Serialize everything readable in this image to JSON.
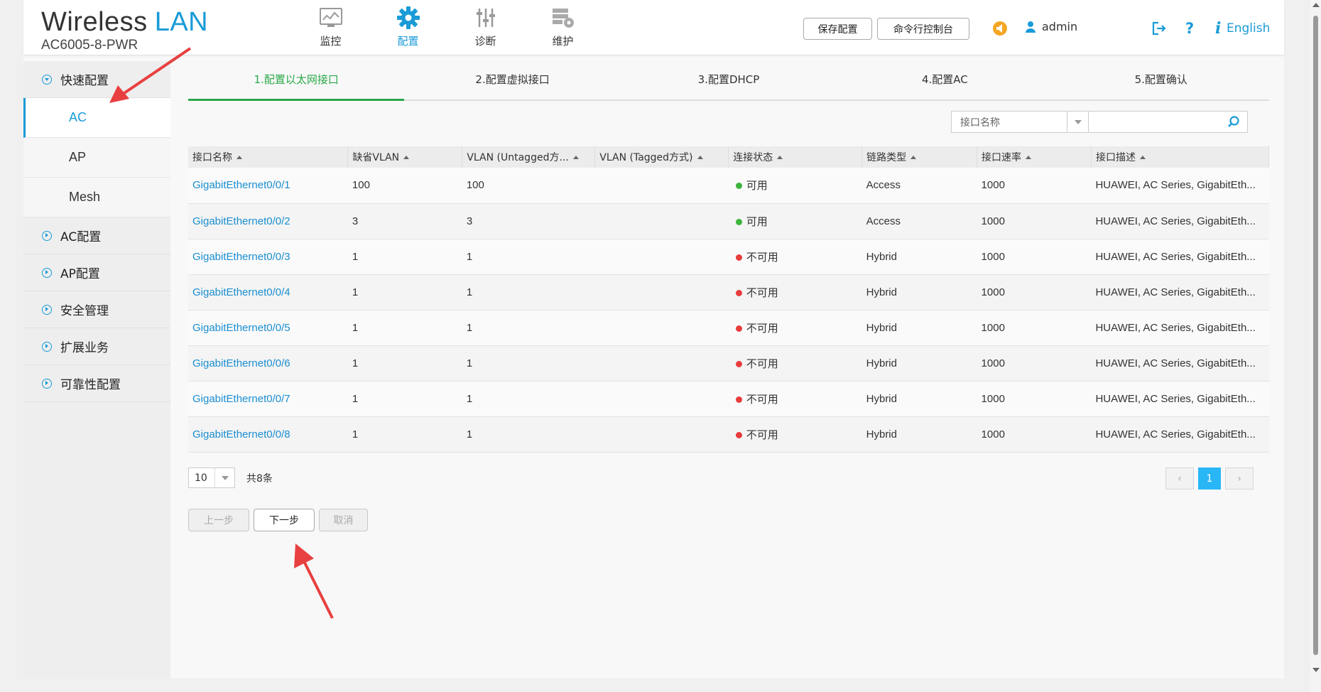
{
  "header": {
    "brand_main": "Wireless",
    "brand_accent": "LAN",
    "model": "AC6005-8-PWR",
    "nav": [
      {
        "label": "监控",
        "icon": "monitor-icon"
      },
      {
        "label": "配置",
        "icon": "gear-icon",
        "active": true
      },
      {
        "label": "诊断",
        "icon": "sliders-icon"
      },
      {
        "label": "维护",
        "icon": "maintenance-icon"
      }
    ],
    "save_label": "保存配置",
    "cli_label": "命令行控制台",
    "user": "admin",
    "language": "English"
  },
  "sidebar": {
    "quick": "快速配置",
    "sub_items": [
      "AC",
      "AP",
      "Mesh"
    ],
    "groups": [
      "AC配置",
      "AP配置",
      "安全管理",
      "扩展业务",
      "可靠性配置"
    ]
  },
  "steps": [
    "1.配置以太网接口",
    "2.配置虚拟接口",
    "3.配置DHCP",
    "4.配置AC",
    "5.配置确认"
  ],
  "search": {
    "field": "接口名称",
    "value": ""
  },
  "table": {
    "columns": [
      "接口名称",
      "缺省VLAN",
      "VLAN (Untagged方...",
      "VLAN (Tagged方式)",
      "连接状态",
      "链路类型",
      "接口速率",
      "接口描述"
    ],
    "rows": [
      {
        "name": "GigabitEthernet0/0/1",
        "pvid": "100",
        "untagged": "100",
        "tagged": "",
        "status": "可用",
        "ok": true,
        "type": "Access",
        "speed": "1000",
        "desc": "HUAWEI, AC Series, GigabitEth..."
      },
      {
        "name": "GigabitEthernet0/0/2",
        "pvid": "3",
        "untagged": "3",
        "tagged": "",
        "status": "可用",
        "ok": true,
        "type": "Access",
        "speed": "1000",
        "desc": "HUAWEI, AC Series, GigabitEth..."
      },
      {
        "name": "GigabitEthernet0/0/3",
        "pvid": "1",
        "untagged": "1",
        "tagged": "",
        "status": "不可用",
        "ok": false,
        "type": "Hybrid",
        "speed": "1000",
        "desc": "HUAWEI, AC Series, GigabitEth..."
      },
      {
        "name": "GigabitEthernet0/0/4",
        "pvid": "1",
        "untagged": "1",
        "tagged": "",
        "status": "不可用",
        "ok": false,
        "type": "Hybrid",
        "speed": "1000",
        "desc": "HUAWEI, AC Series, GigabitEth..."
      },
      {
        "name": "GigabitEthernet0/0/5",
        "pvid": "1",
        "untagged": "1",
        "tagged": "",
        "status": "不可用",
        "ok": false,
        "type": "Hybrid",
        "speed": "1000",
        "desc": "HUAWEI, AC Series, GigabitEth..."
      },
      {
        "name": "GigabitEthernet0/0/6",
        "pvid": "1",
        "untagged": "1",
        "tagged": "",
        "status": "不可用",
        "ok": false,
        "type": "Hybrid",
        "speed": "1000",
        "desc": "HUAWEI, AC Series, GigabitEth..."
      },
      {
        "name": "GigabitEthernet0/0/7",
        "pvid": "1",
        "untagged": "1",
        "tagged": "",
        "status": "不可用",
        "ok": false,
        "type": "Hybrid",
        "speed": "1000",
        "desc": "HUAWEI, AC Series, GigabitEth..."
      },
      {
        "name": "GigabitEthernet0/0/8",
        "pvid": "1",
        "untagged": "1",
        "tagged": "",
        "status": "不可用",
        "ok": false,
        "type": "Hybrid",
        "speed": "1000",
        "desc": "HUAWEI, AC Series, GigabitEth..."
      }
    ]
  },
  "pager": {
    "page_size": "10",
    "total": "共8条",
    "current": "1"
  },
  "buttons": {
    "prev": "上一步",
    "next": "下一步",
    "cancel": "取消"
  },
  "colors": {
    "accent": "#1a9bd7",
    "step_active": "#2aa84a",
    "ok": "#3cb43c",
    "bad": "#e83c3c",
    "annotation": "#e84040"
  }
}
